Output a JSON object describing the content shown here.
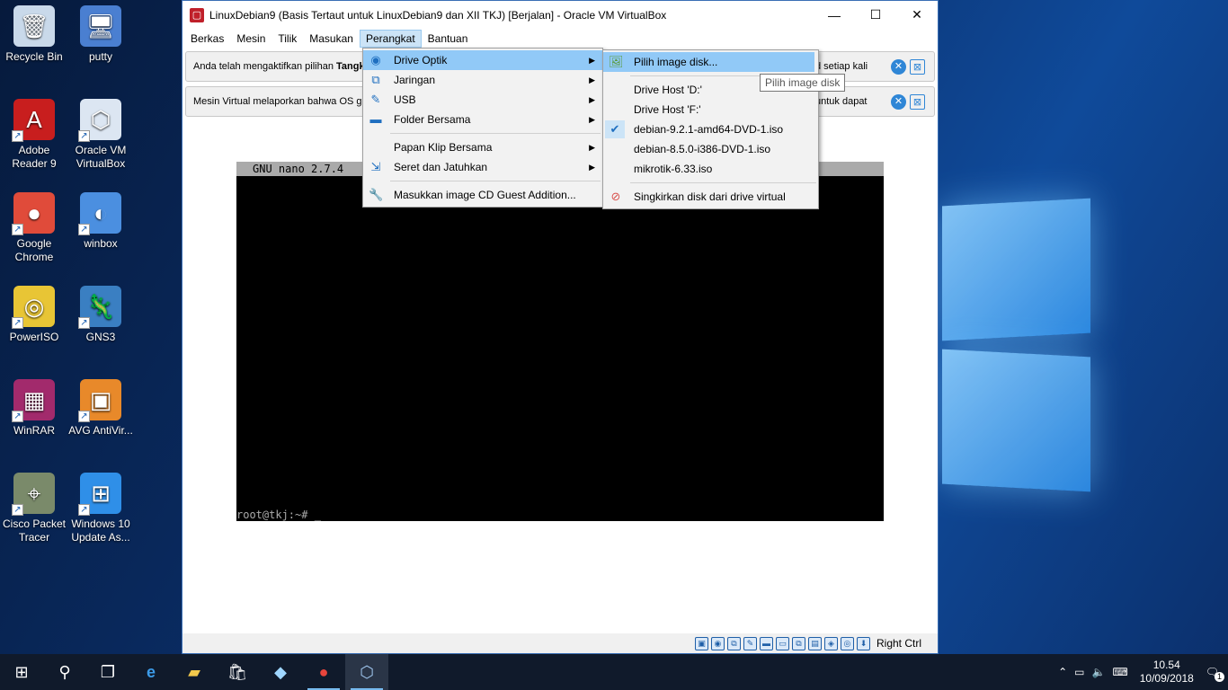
{
  "desktop": {
    "icons": [
      {
        "label": "Recycle Bin",
        "icon": "recycle-bin-icon",
        "glyph": "🗑"
      },
      {
        "label": "putty",
        "icon": "putty-icon",
        "glyph": "🖥"
      },
      {
        "label": "Adobe Reader 9",
        "icon": "adobe-reader-icon",
        "glyph": "A"
      },
      {
        "label": "Oracle VM VirtualBox",
        "icon": "virtualbox-icon",
        "glyph": "⬡"
      },
      {
        "label": "Google Chrome",
        "icon": "chrome-icon",
        "glyph": "●"
      },
      {
        "label": "winbox",
        "icon": "winbox-icon",
        "glyph": "◐"
      },
      {
        "label": "PowerISO",
        "icon": "poweriso-icon",
        "glyph": "◎"
      },
      {
        "label": "GNS3",
        "icon": "gns3-icon",
        "glyph": "🦎"
      },
      {
        "label": "WinRAR",
        "icon": "winrar-icon",
        "glyph": "▦"
      },
      {
        "label": "AVG AntiVir...",
        "icon": "avg-icon",
        "glyph": "▣"
      },
      {
        "label": "Cisco Packet Tracer",
        "icon": "packet-tracer-icon",
        "glyph": "⌖"
      },
      {
        "label": "Windows 10 Update As...",
        "icon": "windows-update-icon",
        "glyph": "⊞"
      }
    ]
  },
  "window": {
    "title": "LinuxDebian9 (Basis Tertaut untuk LinuxDebian9 dan XII TKJ) [Berjalan] - Oracle VM VirtualBox",
    "minimize": "—",
    "maximize": "☐",
    "close": "✕"
  },
  "menubar": {
    "items": [
      "Berkas",
      "Mesin",
      "Tilik",
      "Masukan",
      "Perangkat",
      "Bantuan"
    ],
    "active": "Perangkat"
  },
  "notifications": [
    {
      "text_prefix": "Anda telah mengaktifkan pilihan ",
      "text_bold": "Tangk",
      "text_right": "d setiap kali"
    },
    {
      "text_prefix": "Mesin Virtual melaporkan bahwa OS gue",
      "text_bold": "",
      "text_right": "untuk dapat"
    }
  ],
  "terminal": {
    "header": "GNU nano 2.7.4",
    "prompt": "root@tkj:~# _"
  },
  "perangkat_menu": {
    "items": [
      {
        "label": "Drive Optik",
        "icon": "optical-drive-icon",
        "glyph": "◉",
        "submenu": true,
        "highlight": true
      },
      {
        "label": "Jaringan",
        "icon": "network-icon",
        "glyph": "⧉",
        "submenu": true
      },
      {
        "label": "USB",
        "icon": "usb-icon",
        "glyph": "✎",
        "submenu": true
      },
      {
        "label": "Folder Bersama",
        "icon": "shared-folder-icon",
        "glyph": "▬",
        "submenu": true
      },
      {
        "label": "Papan Klip Bersama",
        "icon": "clipboard-icon",
        "glyph": "",
        "submenu": true,
        "sep_before": true
      },
      {
        "label": "Seret dan Jatuhkan",
        "icon": "drag-drop-icon",
        "glyph": "⇲",
        "submenu": true
      },
      {
        "label": "Masukkan image CD Guest Addition...",
        "icon": "guest-additions-icon",
        "glyph": "🔧",
        "submenu": false,
        "sep_before": true
      }
    ]
  },
  "optical_submenu": {
    "items": [
      {
        "label": "Pilih image disk...",
        "icon": "choose-disk-image-icon",
        "glyph": "🖼",
        "highlight": true
      },
      {
        "label": "Drive Host 'D:'",
        "sep_before": true
      },
      {
        "label": "Drive Host 'F:'"
      },
      {
        "label": "debian-9.2.1-amd64-DVD-1.iso",
        "checked": true
      },
      {
        "label": "debian-8.5.0-i386-DVD-1.iso"
      },
      {
        "label": "mikrotik-6.33.iso"
      },
      {
        "label": "Singkirkan disk dari drive virtual",
        "icon": "eject-disk-icon",
        "glyph": "⊘",
        "sep_before": true
      }
    ]
  },
  "tooltip": "Pilih image disk",
  "statusbar": {
    "host_key": "Right Ctrl",
    "icons": [
      "hdd-icon",
      "optical-icon",
      "network-icon",
      "usb-icon",
      "shared-folder-icon",
      "display-icon",
      "network2-icon",
      "capture-icon",
      "cpu-icon",
      "mouse-integration-icon",
      "host-key-icon"
    ]
  },
  "taskbar": {
    "time": "10.54",
    "date": "10/09/2018",
    "notification_count": "1"
  }
}
